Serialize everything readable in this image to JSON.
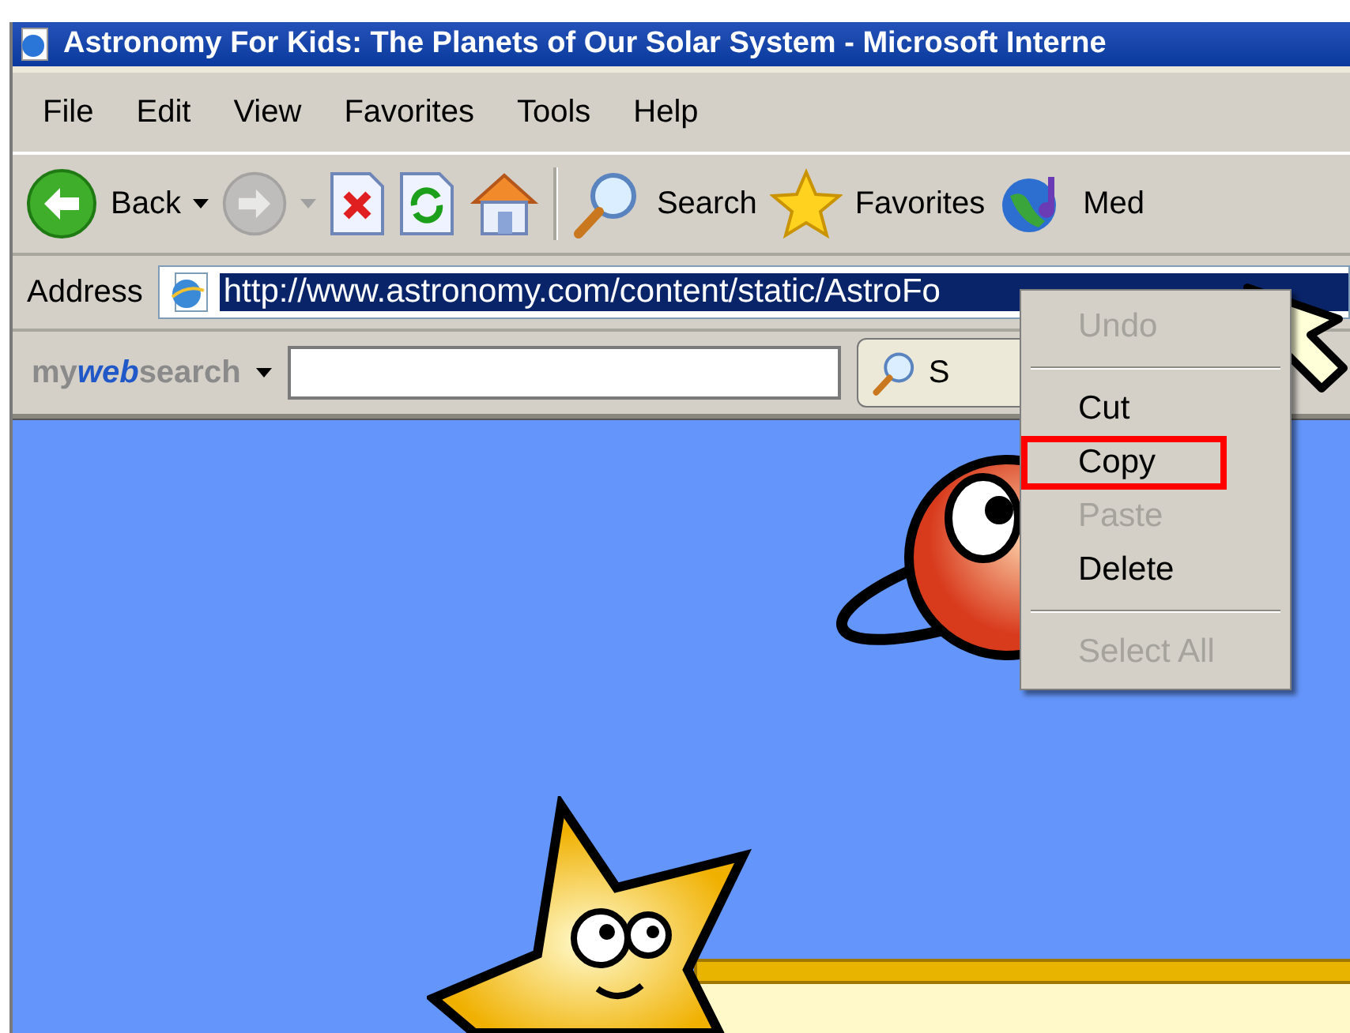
{
  "window": {
    "title": "Astronomy For Kids: The Planets of Our Solar System - Microsoft Interne"
  },
  "menu_bar": [
    "File",
    "Edit",
    "View",
    "Favorites",
    "Tools",
    "Help"
  ],
  "toolbar": [
    {
      "kind": "back",
      "label": "Back",
      "disabled": false
    },
    {
      "kind": "forward",
      "disabled": true
    },
    {
      "kind": "stop",
      "disabled": false
    },
    {
      "kind": "refresh",
      "disabled": false
    },
    {
      "kind": "home",
      "disabled": false
    },
    {
      "kind": "search",
      "label": "Search",
      "disabled": false
    },
    {
      "kind": "favorites",
      "label": "Favorites",
      "disabled": false
    },
    {
      "kind": "media",
      "label": "Med",
      "disabled": false
    }
  ],
  "address": {
    "label": "Address",
    "value": "http://www.astronomy.com/content/static/AstroFo",
    "selected": true
  },
  "search_bar": {
    "brand": "my**web**search",
    "button_label": "S"
  },
  "context_menu": [
    {
      "kind": "item",
      "label": "Undo",
      "disabled": true,
      "selected": false
    },
    {
      "kind": "separator"
    },
    {
      "kind": "item",
      "label": "Cut",
      "disabled": false,
      "selected": false
    },
    {
      "kind": "item",
      "label": "Copy",
      "disabled": false,
      "selected": true
    },
    {
      "kind": "item",
      "label": "Paste",
      "disabled": true,
      "selected": false
    },
    {
      "kind": "item",
      "label": "Delete",
      "disabled": false,
      "selected": false
    },
    {
      "kind": "separator"
    },
    {
      "kind": "item",
      "label": "Select All",
      "disabled": true,
      "selected": false
    }
  ]
}
